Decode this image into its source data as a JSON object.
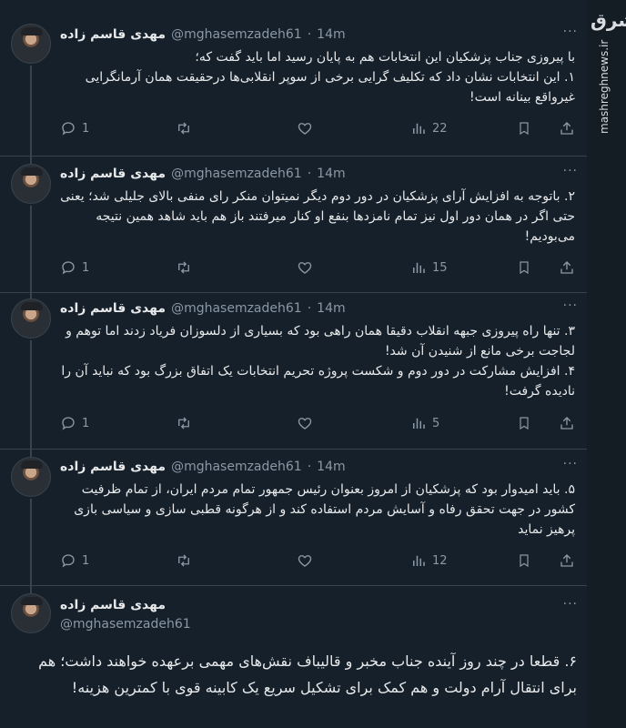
{
  "tweets": [
    {
      "name": "مهدی قاسم زاده",
      "handle": "@mghasemzadeh61",
      "dot": "·",
      "time": "14m",
      "text": "با پیروزی جناب پزشکیان این انتخابات هم به پایان رسید اما باید گفت که؛\n۱. این انتخابات نشان داد که تکلیف گرایی برخی از سوپر انقلابی‌ها درحقیقت همان آرمانگرایی غیرواقع بینانه است!",
      "replies": "1",
      "views": "22"
    },
    {
      "name": "مهدی قاسم زاده",
      "handle": "@mghasemzadeh61",
      "dot": "·",
      "time": "14m",
      "text": "۲. باتوجه به افزایش آرای پزشکیان در دور دوم دیگر نمیتوان منکر رای منفی بالای جلیلی شد؛ یعنی حتی اگر در همان دور اول نیز تمام نامزدها بنفع او کنار میرفتند باز هم باید شاهد همین نتیجه می‌بودیم!",
      "replies": "1",
      "views": "15"
    },
    {
      "name": "مهدی قاسم زاده",
      "handle": "@mghasemzadeh61",
      "dot": "·",
      "time": "14m",
      "text": "۳. تنها راه پیروزی جبهه انقلاب دقیقا همان راهی بود که بسیاری از دلسوزان فریاد زدند اما توهم و لجاجت برخی مانع از شنیدن آن شد!\n۴. افزایش مشارکت در دور دوم و شکست پروژه تحریم انتخابات یک اتفاق بزرگ بود که نباید آن را نادیده گرفت!",
      "replies": "1",
      "views": "5"
    },
    {
      "name": "مهدی قاسم زاده",
      "handle": "@mghasemzadeh61",
      "dot": "·",
      "time": "14m",
      "text": "۵. باید امیدوار بود که پزشکیان از امروز بعنوان رئیس جمهور تمام مردم ایران، از تمام ظرفیت کشور در جهت تحقق رفاه و آسایش مردم استفاده کند و از هرگونه قطبی سازی و سیاسی بازی پرهیز نماید",
      "replies": "1",
      "views": "12"
    }
  ],
  "final_tweet": {
    "name": "مهدی قاسم زاده",
    "handle": "@mghasemzadeh61",
    "text": "۶. قطعا در چند روز آینده جناب مخبر و قالیباف نقش‌های مهمی برعهده خواهند داشت؛ هم برای انتقال آرام دولت و هم کمک برای تشکیل سریع یک کابینه قوی با کمترین هزینه!"
  },
  "more_glyph": "···",
  "watermark": {
    "logo": "مشرق",
    "site": "mashreghnews.ir"
  },
  "colors": {
    "background": "#15202b",
    "text": "#e7e9ea",
    "muted": "#8b98a5",
    "divider": "#38444d"
  }
}
